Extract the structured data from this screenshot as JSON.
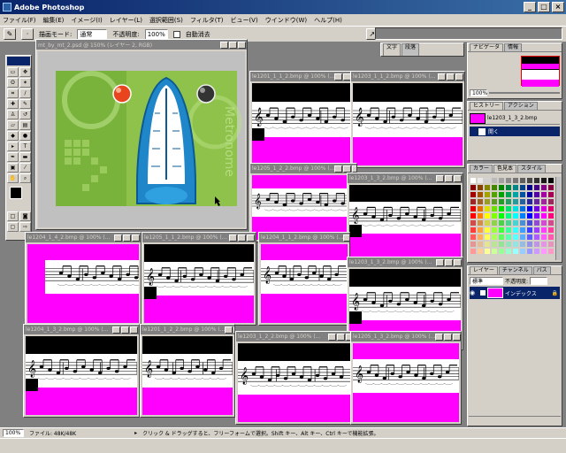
{
  "app": {
    "title": "Adobe Photoshop"
  },
  "menu": [
    "ファイル(F)",
    "編集(E)",
    "イメージ(I)",
    "レイヤー(L)",
    "選択範囲(S)",
    "フィルタ(T)",
    "ビュー(V)",
    "ウインドウ(W)",
    "ヘルプ(H)"
  ],
  "options": {
    "mode_label": "描画モード:",
    "mode_value": "通常",
    "opacity_label": "不透明度:",
    "opacity_value": "100%",
    "auto_erase_label": "自動消去"
  },
  "metronome_window": {
    "title": "mt_by_mt_2.psd @ 150% (レイヤー 2, RGB)",
    "watermark": "Metronome"
  },
  "docs": [
    {
      "title": "le1201_1_1_2.bmp @ 100% (..."
    },
    {
      "title": "le1203_1_1_2.bmp @ 100% (..."
    },
    {
      "title": "le1205_1_2_2.bmp @ 100% (..."
    },
    {
      "title": "le1203_1_3_2.bmp @ 100% (..."
    },
    {
      "title": "le1204_1_4_2.bmp @ 100% (..."
    },
    {
      "title": "le1205_1_1_2.bmp @ 100% (..."
    },
    {
      "title": "le1204_1_1_2.bmp @ 100% (..."
    },
    {
      "title": "le1203_1_3_2.bmp @ 100% (..."
    },
    {
      "title": "le1204_1_3_2.bmp @ 100% (..."
    },
    {
      "title": "le1201_1_2_2.bmp @ 100% (..."
    },
    {
      "title": "le1203_1_2_2.bmp @ 100% (..."
    },
    {
      "title": "le1205_1_3_2.bmp @ 100% (..."
    }
  ],
  "panels": {
    "navigator_tabs": [
      "ナビゲータ",
      "情報"
    ],
    "navigator_zoom": "100%",
    "history_tabs": [
      "ヒストリー",
      "アクション"
    ],
    "history_items": [
      "le1203_1_3_2.bmp",
      "開く"
    ],
    "color_tabs": [
      "カラー",
      "色見本",
      "スタイル"
    ],
    "layers_tabs": [
      "レイヤー",
      "チャンネル",
      "パス"
    ],
    "layers_mode": "標準",
    "layers_opacity_label": "不透明度:",
    "layer_name": "インデックス",
    "text_tabs": [
      "文字",
      "段落"
    ]
  },
  "status": {
    "zoom": "100%",
    "file": "ファイル: 48K/48K",
    "hint": "クリック & ドラッグすると、フリーフォームで選択。Shift キー、Alt キー、Ctrl キーで機能拡張。"
  }
}
